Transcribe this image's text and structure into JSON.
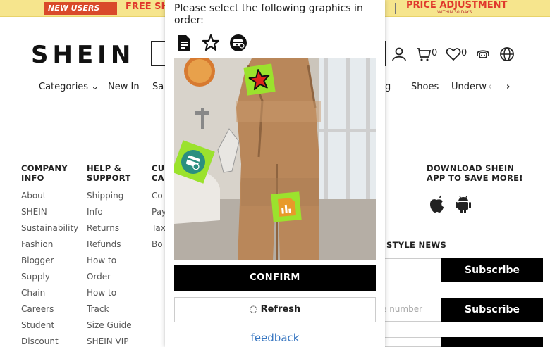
{
  "promo": {
    "new_badge": "NEW USERS ONLY",
    "free_text": "FREE SH",
    "price_text": "PRICE ADJUSTMENT",
    "price_sub": "WITHIN 30 DAYS"
  },
  "header": {
    "logo": "SHEIN",
    "cart_count": "0",
    "wishlist_count": "0"
  },
  "nav": {
    "items": [
      "Categories",
      "New In",
      "Sa",
      "g",
      "Shoes",
      "Underw"
    ]
  },
  "footer": {
    "company": {
      "title": "COMPANY INFO",
      "links": [
        "About",
        "SHEIN",
        "Sustainability",
        "Fashion",
        "Blogger",
        "Supply",
        "Chain",
        "Careers",
        "Student",
        "Discount"
      ]
    },
    "help": {
      "title": "HELP & SUPPORT",
      "links": [
        "Shipping",
        "Info",
        "Returns",
        "Refunds",
        "How to",
        "Order",
        "How to",
        "Track",
        "Size Guide",
        "SHEIN VIP"
      ]
    },
    "customer": {
      "title": "CU CA",
      "links": [
        "Co",
        "Pay",
        "Tax",
        "Bo"
      ]
    },
    "download": {
      "title": "DOWNLOAD SHEIN APP TO SAVE MORE!"
    },
    "newsletter": {
      "title": "STYLE NEWS",
      "subscribe_label": "Subscribe",
      "phone_placeholder": "e number"
    }
  },
  "captcha": {
    "prompt": "Please select the following graphics in order:",
    "sequence_icons": [
      "document-icon",
      "star-icon",
      "card-icon"
    ],
    "confirm_label": "CONFIRM",
    "refresh_label": "Refresh",
    "feedback_label": "feedback",
    "accent": "#9be22d"
  }
}
